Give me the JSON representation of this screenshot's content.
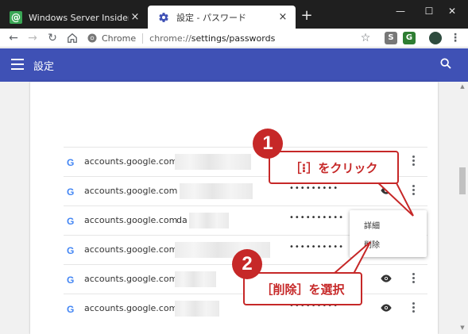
{
  "browser": {
    "tabs": [
      {
        "title": "Windows Server Insider：企業情報",
        "close": "×",
        "active": false
      },
      {
        "title": "設定 - パスワード",
        "close": "×",
        "active": true
      }
    ],
    "new_tab": "+",
    "window_controls": {
      "minimize": "—",
      "maximize": "☐",
      "close": "✕"
    },
    "omnibox": {
      "chip_label": "Chrome",
      "url_scheme": "chrome://",
      "url_path": "settings/passwords"
    },
    "extensions": [
      "S",
      "G"
    ]
  },
  "settings": {
    "title": "設定",
    "accent_color": "#3f51b5"
  },
  "passwords": {
    "rows": [
      {
        "site": "accounts.google.com",
        "user": "",
        "password": "",
        "show_eye": false
      },
      {
        "site": "accounts.google.com",
        "user": "",
        "password": "•••••••••",
        "show_eye": true
      },
      {
        "site": "accounts.google.com",
        "user": "da",
        "password": "••••••••••",
        "show_eye": false
      },
      {
        "site": "accounts.google.com",
        "user": "",
        "password": "••••••••••",
        "show_eye": false
      },
      {
        "site": "accounts.google.com",
        "user": "",
        "password": "•••••••••",
        "show_eye": true
      },
      {
        "site": "accounts.google.com",
        "user": "",
        "password": "•••••••••",
        "show_eye": true
      }
    ]
  },
  "context_menu": {
    "items": [
      "詳細",
      "削除"
    ]
  },
  "annotations": {
    "step1": {
      "number": "1",
      "text": "［⁝］をクリック"
    },
    "step2": {
      "number": "2",
      "text": "［削除］を選択"
    },
    "color": "#c62828"
  }
}
